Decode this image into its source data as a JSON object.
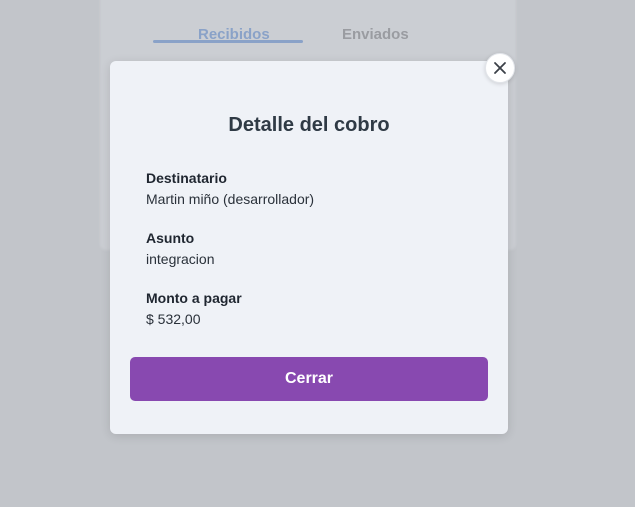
{
  "background": {
    "tabs": [
      "Recibidos",
      "Enviados"
    ]
  },
  "modal": {
    "title": "Detalle del cobro",
    "fields": [
      {
        "label": "Destinatario",
        "value": "Martin miño (desarrollador)"
      },
      {
        "label": "Asunto",
        "value": "integracion"
      },
      {
        "label": "Monto a pagar",
        "value": "$ 532,00"
      }
    ],
    "close_button_label": "Cerrar"
  },
  "icons": {
    "close": "close-icon"
  },
  "colors": {
    "primary_button": "#8849b0",
    "modal_background": "#eff2f7",
    "overlay": "#c2c5ca"
  }
}
